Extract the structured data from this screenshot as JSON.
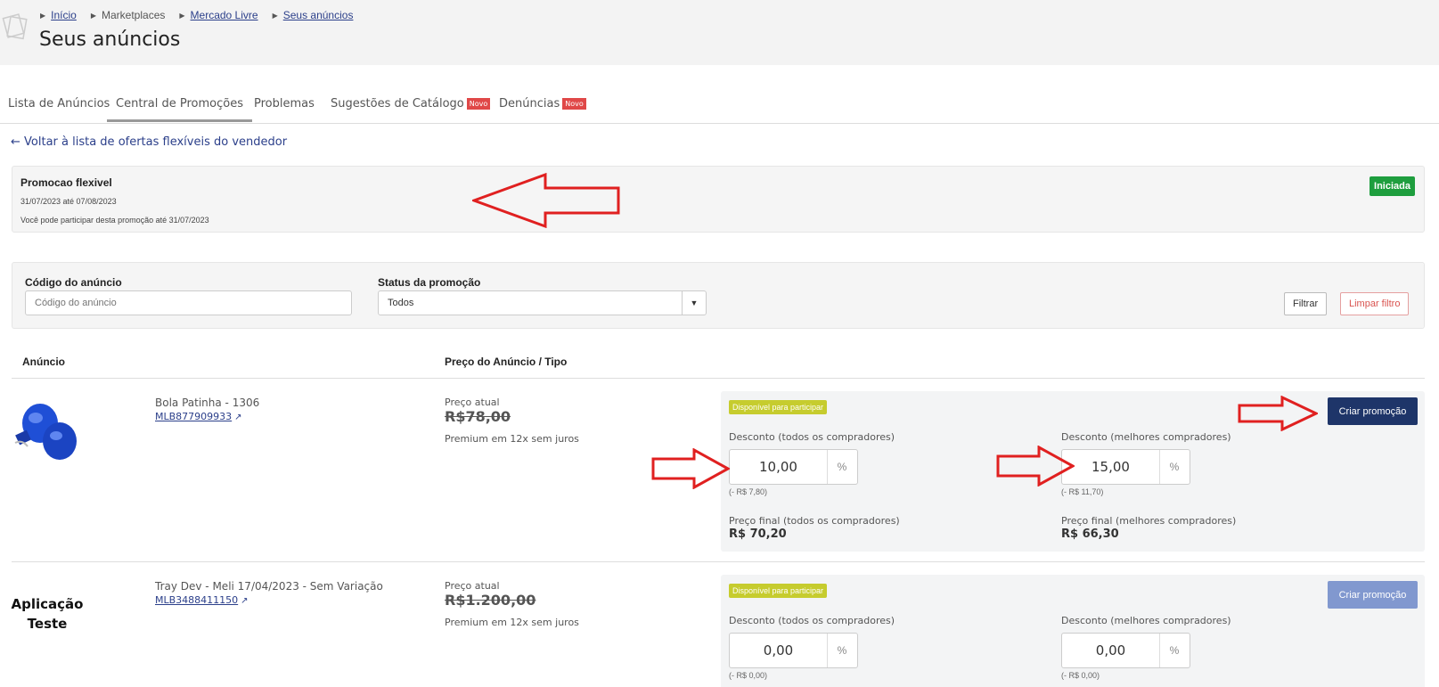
{
  "breadcrumb": {
    "inicio": "Início",
    "marketplaces": "Marketplaces",
    "mercado_livre": "Mercado Livre",
    "seus_anuncios": "Seus anúncios"
  },
  "page_title": "Seus anúncios",
  "tabs": {
    "lista": "Lista de Anúncios",
    "central": "Central de Promoções",
    "problemas": "Problemas",
    "sugestoes": "Sugestões de Catálogo",
    "denuncias": "Denúncias",
    "novo_badge": "Novo"
  },
  "back_link": "← Voltar à lista de ofertas flexíveis do vendedor",
  "promo": {
    "title": "Promocao flexivel",
    "dates": "31/07/2023 até 07/08/2023",
    "note": "Você pode participar desta promoção até 31/07/2023",
    "status": "Iniciada"
  },
  "filters": {
    "codigo_label": "Código do anúncio",
    "codigo_placeholder": "Código do anúncio",
    "status_label": "Status da promoção",
    "status_value": "Todos",
    "filtrar": "Filtrar",
    "limpar": "Limpar filtro"
  },
  "table": {
    "col_anuncio": "Anúncio",
    "col_preco": "Preço do Anúncio / Tipo"
  },
  "labels": {
    "preco_atual": "Preço atual",
    "disponivel": "Disponível para participar",
    "desc_todos": "Desconto (todos os compradores)",
    "desc_melhores": "Desconto (melhores compradores)",
    "final_todos": "Preço final (todos os compradores)",
    "final_melhores": "Preço final (melhores compradores)",
    "pct": "%",
    "criar": "Criar promoção"
  },
  "rows": [
    {
      "name": "Bola Patinha - 1306",
      "code": "MLB877909933",
      "price": "R$78,00",
      "type": "Premium em 12x sem juros",
      "disc_todos": "10,00",
      "diff_todos": "(- R$ 7,80)",
      "disc_melhores": "15,00",
      "diff_melhores": "(- R$ 11,70)",
      "final_todos": "R$ 70,20",
      "final_melhores": "R$ 66,30"
    },
    {
      "name": "Tray Dev - Meli 17/04/2023 - Sem Variação",
      "code": "MLB3488411150",
      "price": "R$1.200,00",
      "type": "Premium em 12x sem juros",
      "image_text_1": "Aplicação",
      "image_text_2": "Teste",
      "disc_todos": "0,00",
      "diff_todos": "(- R$ 0,00)",
      "disc_melhores": "0,00",
      "diff_melhores": "(- R$ 0,00)"
    }
  ],
  "colors": {
    "primary": "#1e3569",
    "primary_disabled": "#8198cf",
    "success": "#1e9e3e",
    "badge_new": "#e04848",
    "badge_available": "#c6cc2e",
    "annotation_arrow": "#e02020"
  }
}
